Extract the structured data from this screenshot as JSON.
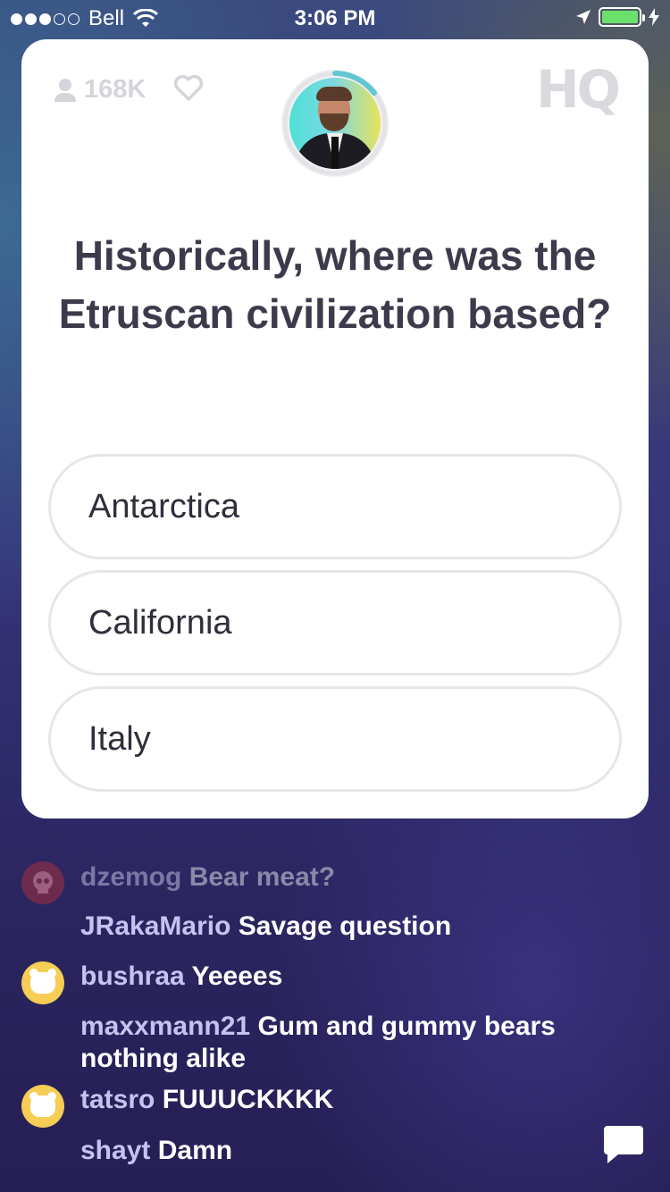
{
  "status_bar": {
    "carrier": "Bell",
    "time": "3:06 PM",
    "battery_color": "#6be06b"
  },
  "card": {
    "viewer_count": "168K",
    "logo": "HQ",
    "question": "Historically, where was the Etruscan civilization based?",
    "answers": [
      {
        "label": "Antarctica"
      },
      {
        "label": "California"
      },
      {
        "label": "Italy"
      }
    ]
  },
  "chat": {
    "messages": [
      {
        "user": "dzemog",
        "text": "Bear meat?",
        "avatar": "skull-icon"
      },
      {
        "user": "JRakaMario",
        "text": "Savage question",
        "avatar": ""
      },
      {
        "user": "bushraa",
        "text": "Yeeees",
        "avatar": "bear-icon"
      },
      {
        "user": "maxxmann21",
        "text": "Gum and gummy bears nothing alike",
        "avatar": ""
      },
      {
        "user": "tatsro",
        "text": "FUUUCKKKK",
        "avatar": "bear-icon"
      },
      {
        "user": "shayt",
        "text": "Damn",
        "avatar": ""
      }
    ]
  },
  "colors": {
    "card_bg": "#ffffff",
    "question_text": "#3b3b4c",
    "chat_username": "#c7c2f0",
    "avatar_yellow": "#f6cd55"
  }
}
